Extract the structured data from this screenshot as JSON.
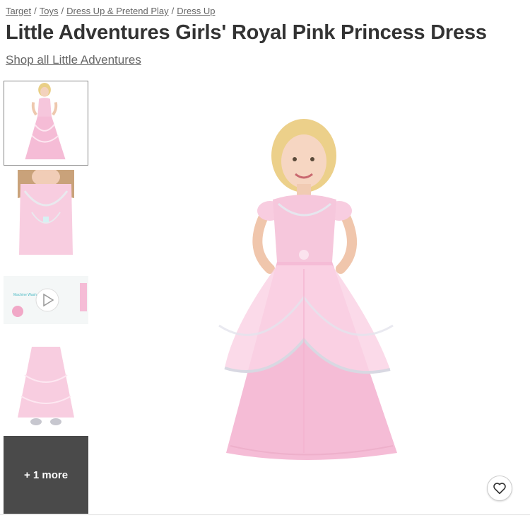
{
  "breadcrumb": [
    "Target",
    "Toys",
    "Dress Up & Pretend Play",
    "Dress Up"
  ],
  "breadcrumb_separator": "/",
  "title": "Little Adventures Girls' Royal Pink Princess Dress",
  "shop_link": "Shop all Little Adventures",
  "thumbnails": {
    "more_label": "+ 1 more",
    "video_caption": "Machine Wash"
  },
  "colors": {
    "dress_pink": "#f5bcd6",
    "dress_light": "#fbdcea",
    "more_tile_bg": "#4a4a4a",
    "text": "#333333"
  },
  "icons": {
    "favorite": "heart-outline-icon",
    "video": "play-icon"
  }
}
